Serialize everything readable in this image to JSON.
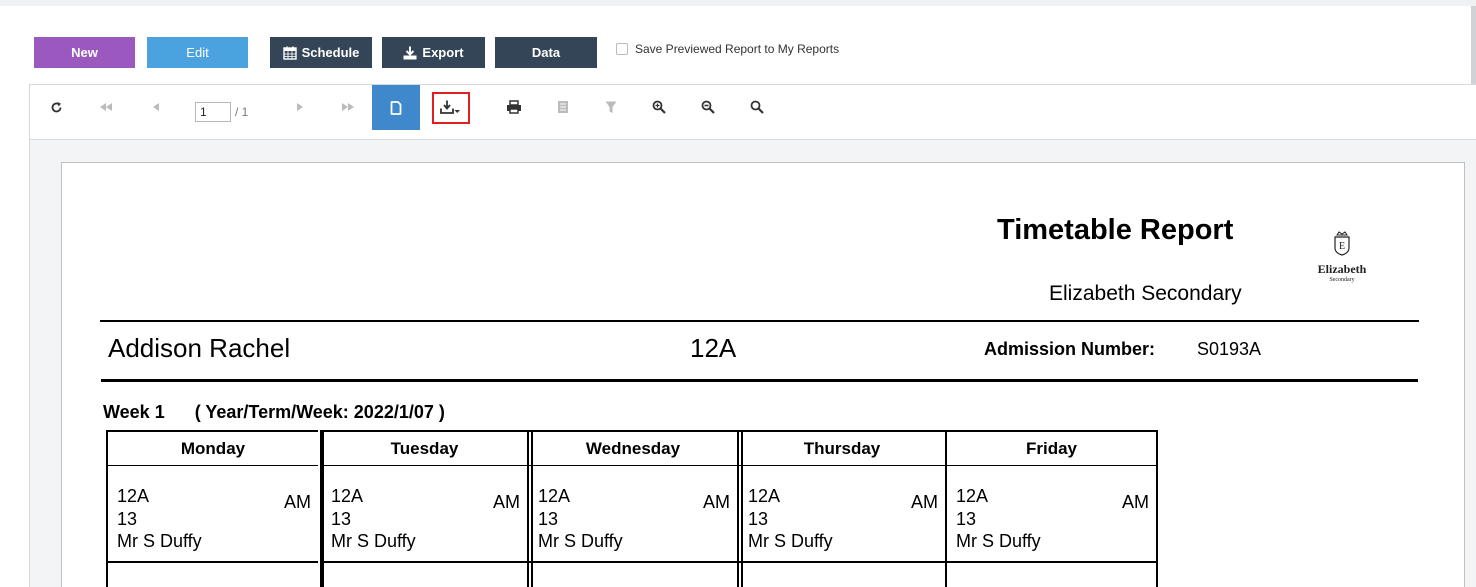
{
  "actions": {
    "new_label": "New",
    "edit_label": "Edit",
    "schedule_label": "Schedule",
    "export_label": "Export",
    "data_label": "Data",
    "save_checkbox_label": "Save Previewed Report to My Reports"
  },
  "viewer": {
    "page_current": "1",
    "page_total": "/ 1"
  },
  "report": {
    "title": "Timetable Report",
    "school": "Elizabeth Secondary",
    "logo_name": "Elizabeth",
    "logo_sub": "Secondary",
    "student_name": "Addison Rachel",
    "class": "12A",
    "admission_label": "Admission Number:",
    "admission_value": "S0193A",
    "week_label": "Week 1",
    "week_range": "( Year/Term/Week: 2022/1/07 )"
  },
  "timetable": {
    "days": [
      "Monday",
      "Tuesday",
      "Wednesday",
      "Thursday",
      "Friday"
    ],
    "entries": [
      {
        "class": "12A",
        "room": "13",
        "teacher": "Mr S Duffy",
        "period": "AM"
      },
      {
        "class": "12A",
        "room": "13",
        "teacher": "Mr S Duffy",
        "period": "AM"
      },
      {
        "class": "12A",
        "room": "13",
        "teacher": "Mr S Duffy",
        "period": "AM"
      },
      {
        "class": "12A",
        "room": "13",
        "teacher": "Mr S Duffy",
        "period": "AM"
      },
      {
        "class": "12A",
        "room": "13",
        "teacher": "Mr S Duffy",
        "period": "AM"
      }
    ]
  },
  "colors": {
    "new": "#9b59c0",
    "edit": "#4aa3df",
    "dark": "#344557",
    "active_tool": "#3f88cc",
    "highlight": "#e02020"
  },
  "icons": [
    "refresh-icon",
    "first-page-icon",
    "prev-page-icon",
    "next-page-icon",
    "last-page-icon",
    "single-page-icon",
    "export-download-icon",
    "print-icon",
    "document-map-icon",
    "filter-icon",
    "zoom-in-icon",
    "zoom-out-icon",
    "zoom-fit-icon"
  ]
}
